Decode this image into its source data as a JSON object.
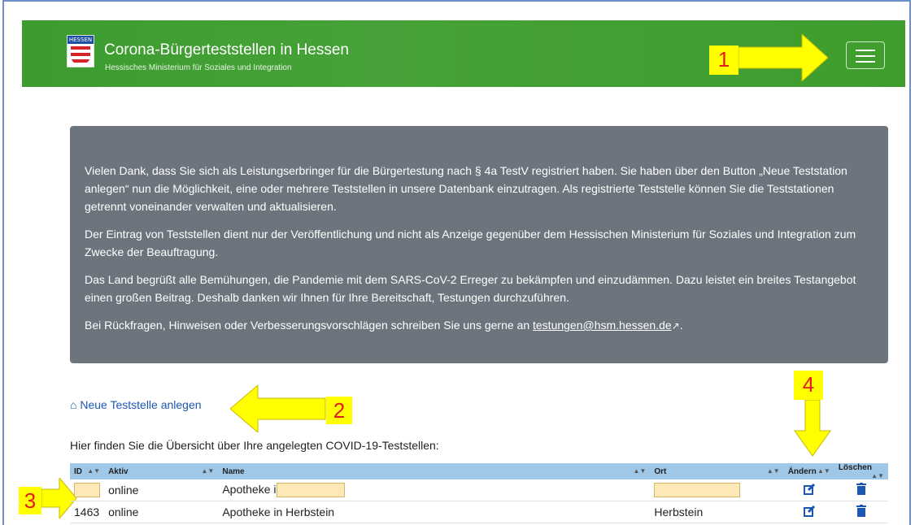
{
  "header": {
    "logo_label": "HESSEN",
    "title": "Corona-Bürgerteststellen in Hessen",
    "subtitle": "Hessisches Ministerium für Soziales und Integration"
  },
  "annotations": [
    "1",
    "2",
    "3",
    "4"
  ],
  "info": {
    "p1": "Vielen Dank, dass Sie sich als Leistungserbringer für die Bürgertestung nach § 4a TestV registriert haben. Sie haben über den Button „Neue Teststation anlegen“ nun die Möglichkeit, eine oder mehrere Teststellen in unsere Datenbank einzutragen. Als registrierte Teststelle können Sie die Teststationen getrennt voneinander verwalten und aktualisieren.",
    "p2": "Der Eintrag von Teststellen dient nur der Veröffentlichung und nicht als Anzeige gegenüber dem Hessischen Ministerium für Soziales und Integration zum Zwecke der Beauftragung.",
    "p3": "Das Land begrüßt alle Bemühungen, die Pandemie mit dem SARS-CoV-2 Erreger zu bekämpfen und einzudämmen. Dazu leistet ein breites Testangebot einen großen Beitrag. Deshalb danken wir Ihnen für Ihre Bereitschaft, Testungen durchzuführen.",
    "p4_prefix": "Bei Rückfragen, Hinweisen oder Verbesserungsvorschlägen schreiben Sie uns gerne an",
    "email": "testungen@hsm.hessen.de",
    "p4_suffix": "."
  },
  "new_station_link": "Neue Teststelle anlegen",
  "overview_text": "Hier finden Sie die Übersicht über Ihre angelegten COVID-19-Teststellen:",
  "table": {
    "columns": [
      "ID",
      "Aktiv",
      "Name",
      "Ort",
      "Ändern",
      "Löschen"
    ],
    "rows": [
      {
        "id": "",
        "aktiv": "online",
        "name": "Apotheke i",
        "ort": ""
      },
      {
        "id": "1463",
        "aktiv": "online",
        "name": "Apotheke in Herbstein",
        "ort": "Herbstein"
      }
    ]
  },
  "colors": {
    "navbar": "#46a238",
    "infobox": "#6c757d",
    "table_header": "#9ec7e8",
    "annotation_bg": "#ffff00",
    "annotation_text": "#e21b1b",
    "link": "#1c57b4"
  }
}
